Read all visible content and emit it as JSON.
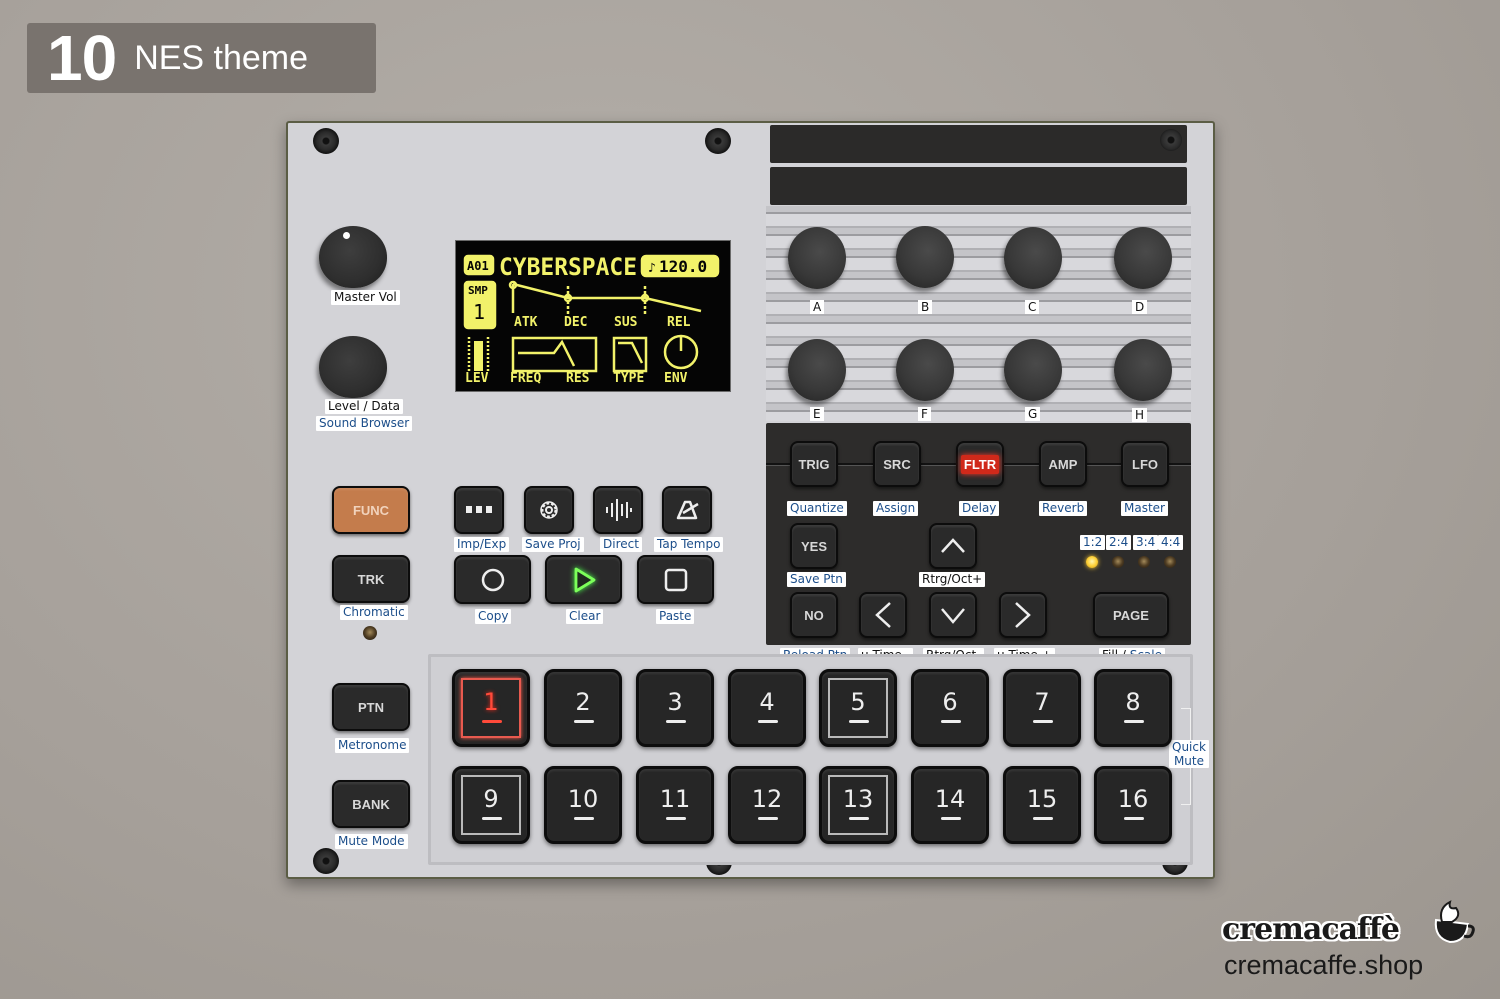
{
  "title": {
    "number": "10",
    "text": "NES theme"
  },
  "screen": {
    "slot": "A01",
    "track_name": "CYBERSPACE",
    "tempo": "120.0",
    "tempo_icon": "metronome-icon",
    "sample_label": "SMP",
    "sample_number": "1",
    "envelope_labels": [
      "ATK",
      "DEC",
      "SUS",
      "REL"
    ],
    "bottom_labels": [
      "LEV",
      "FREQ",
      "RES",
      "TYPE",
      "ENV"
    ],
    "color": "#f2f26a"
  },
  "knobs": {
    "master_vol": "Master Vol",
    "level_data": "Level / Data",
    "sound_browser": "Sound Browser"
  },
  "encoders": [
    "A",
    "B",
    "C",
    "D",
    "E",
    "F",
    "G",
    "H"
  ],
  "left_buttons": {
    "func": "FUNC",
    "trk": "TRK",
    "trk_alt": "Chromatic",
    "ptn": "PTN",
    "ptn_alt": "Metronome",
    "bank": "BANK",
    "bank_alt": "Mute Mode"
  },
  "icon_buttons": [
    {
      "icon": "more-icon",
      "label": "Imp/Exp"
    },
    {
      "icon": "gear-icon",
      "label": "Save Proj"
    },
    {
      "icon": "waveform-icon",
      "label": "Direct"
    },
    {
      "icon": "metronome-icon",
      "label": "Tap Tempo"
    }
  ],
  "transport": [
    {
      "icon": "record-icon",
      "label": "Copy"
    },
    {
      "icon": "play-icon",
      "label": "Clear",
      "active": true
    },
    {
      "icon": "stop-icon",
      "label": "Paste"
    }
  ],
  "page_buttons": [
    {
      "label": "TRIG",
      "alt": "Quantize"
    },
    {
      "label": "SRC",
      "alt": "Assign"
    },
    {
      "label": "FLTR",
      "alt": "Delay",
      "active": true
    },
    {
      "label": "AMP",
      "alt": "Reverb"
    },
    {
      "label": "LFO",
      "alt": "Master"
    }
  ],
  "nav": {
    "yes": "YES",
    "yes_alt": "Save Ptn",
    "no": "NO",
    "no_alt": "Reload Ptn",
    "up_alt": "Rtrg/Oct+",
    "down_alt": "Rtrg/Oct-",
    "left_alt": "µ Time -",
    "right_alt": "µ Time +",
    "page": "PAGE",
    "page_alt_1": "Fill / ",
    "page_alt_2": "Scale"
  },
  "page_indicators": {
    "labels": [
      "1:2",
      "2:4",
      "3:4",
      "4:4"
    ],
    "active_index": 0
  },
  "pads": [
    {
      "n": "1",
      "state": "active"
    },
    {
      "n": "2"
    },
    {
      "n": "3"
    },
    {
      "n": "4"
    },
    {
      "n": "5",
      "state": "boxed"
    },
    {
      "n": "6"
    },
    {
      "n": "7"
    },
    {
      "n": "8"
    },
    {
      "n": "9",
      "state": "boxed"
    },
    {
      "n": "10"
    },
    {
      "n": "11"
    },
    {
      "n": "12"
    },
    {
      "n": "13",
      "state": "boxed"
    },
    {
      "n": "14"
    },
    {
      "n": "15"
    },
    {
      "n": "16"
    }
  ],
  "quick_mute": [
    "Quick",
    "Mute"
  ],
  "branding": {
    "name": "cremacaffè",
    "url": "cremacaffe.shop"
  }
}
